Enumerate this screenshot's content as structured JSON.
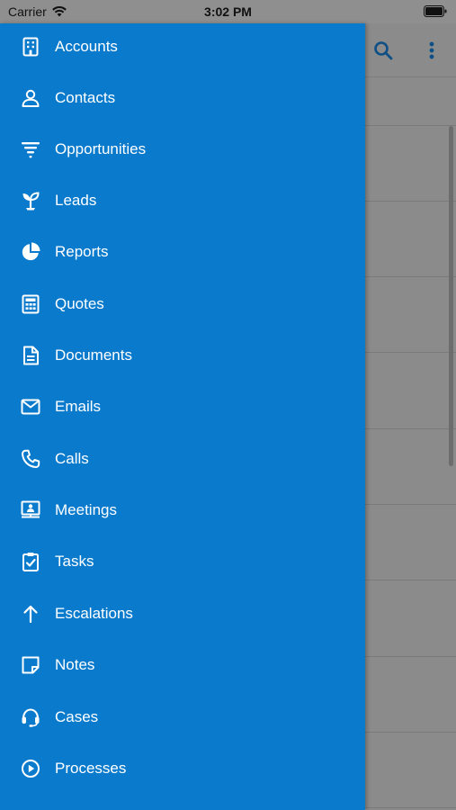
{
  "status_bar": {
    "carrier": "Carrier",
    "time": "3:02 PM"
  },
  "background": {
    "icons": [
      "search-icon",
      "more-vertical-icon"
    ],
    "dim_color": "#8b8b8b"
  },
  "drawer": {
    "color": "#0a7acd",
    "items": [
      {
        "label": "Accounts",
        "icon": "building-icon"
      },
      {
        "label": "Contacts",
        "icon": "person-icon"
      },
      {
        "label": "Opportunities",
        "icon": "funnel-icon"
      },
      {
        "label": "Leads",
        "icon": "sprout-icon"
      },
      {
        "label": "Reports",
        "icon": "pie-chart-icon"
      },
      {
        "label": "Quotes",
        "icon": "calculator-icon"
      },
      {
        "label": "Documents",
        "icon": "document-icon"
      },
      {
        "label": "Emails",
        "icon": "envelope-icon"
      },
      {
        "label": "Calls",
        "icon": "phone-icon"
      },
      {
        "label": "Meetings",
        "icon": "presentation-icon"
      },
      {
        "label": "Tasks",
        "icon": "clipboard-check-icon"
      },
      {
        "label": "Escalations",
        "icon": "arrow-up-icon"
      },
      {
        "label": "Notes",
        "icon": "note-icon"
      },
      {
        "label": "Cases",
        "icon": "headset-icon"
      },
      {
        "label": "Processes",
        "icon": "play-circle-icon"
      }
    ]
  }
}
